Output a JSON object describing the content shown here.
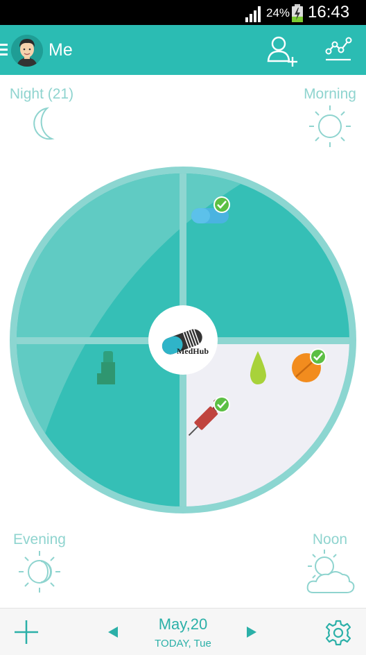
{
  "status_bar": {
    "battery_percent": "24%",
    "time": "16:43"
  },
  "header": {
    "title": "Me",
    "icons": [
      "menu-icon",
      "avatar",
      "add-user-icon",
      "chart-icon"
    ]
  },
  "periods": {
    "night": "Night (21)",
    "morning": "Morning",
    "evening": "Evening",
    "noon": "Noon"
  },
  "wheel": {
    "logo_text": "MedHub",
    "quadrants": [
      {
        "name": "night",
        "meds": []
      },
      {
        "name": "morning",
        "meds": [
          {
            "icon": "capsule-icon",
            "taken": true
          }
        ]
      },
      {
        "name": "evening",
        "meds": [
          {
            "icon": "inhaler-icon",
            "taken": false
          }
        ]
      },
      {
        "name": "noon",
        "meds": [
          {
            "icon": "drop-icon",
            "taken": false
          },
          {
            "icon": "tablet-icon",
            "taken": true
          },
          {
            "icon": "syringe-icon",
            "taken": true
          }
        ]
      }
    ],
    "colors": {
      "ring": "#8cd6d1",
      "quadrant_light": "#63cbc4",
      "quadrant_dark": "#35bfb6",
      "selected": "#efeff5",
      "divider": "#8fd6d1"
    }
  },
  "footer": {
    "date": "May,20",
    "day_label": "TODAY, Tue",
    "icons": [
      "add-icon",
      "prev-arrow-icon",
      "next-arrow-icon",
      "settings-icon"
    ]
  },
  "accent_color": "#2bbcb3"
}
